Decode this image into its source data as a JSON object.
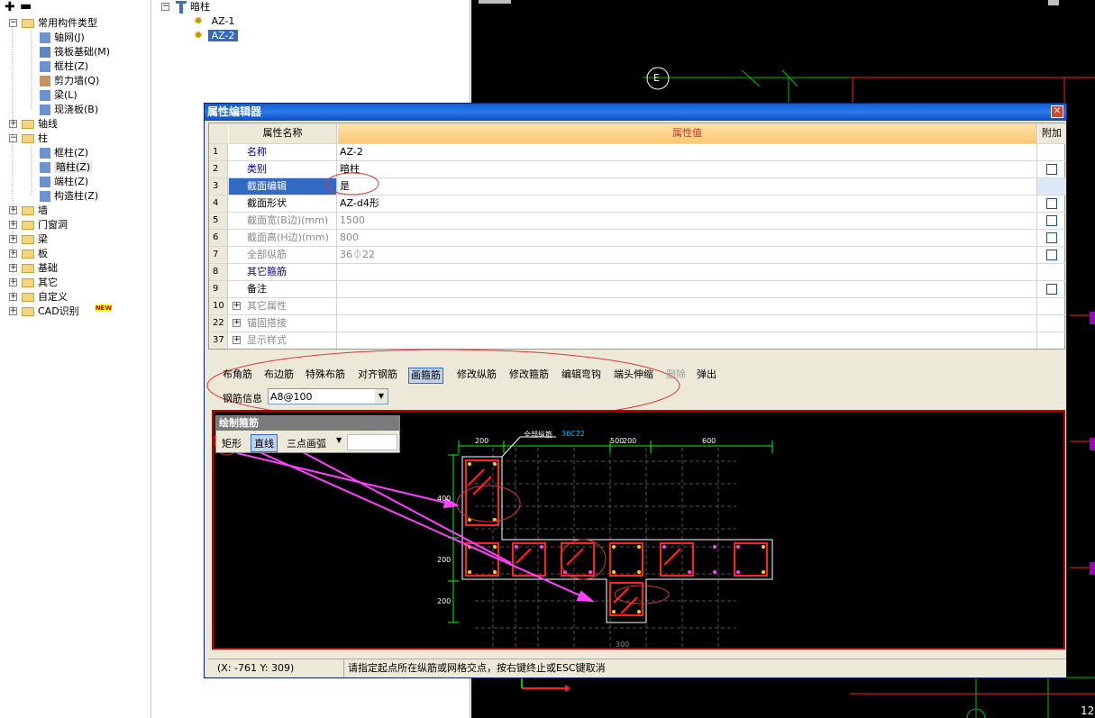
{
  "left_tree": {
    "items": [
      {
        "label": "常用构件类型",
        "level": 0,
        "expander": "⊟",
        "kind": "folder"
      },
      {
        "label": "轴网(J)",
        "level": 1,
        "kind": "grid"
      },
      {
        "label": "筏板基础(M)",
        "level": 1,
        "kind": "raft"
      },
      {
        "label": "框柱(Z)",
        "level": 1,
        "kind": "column"
      },
      {
        "label": "剪力墙(Q)",
        "level": 1,
        "kind": "wall"
      },
      {
        "label": "梁(L)",
        "level": 1,
        "kind": "beam"
      },
      {
        "label": "现浇板(B)",
        "level": 1,
        "kind": "slab"
      },
      {
        "label": "轴线",
        "level": 0,
        "expander": "⊞",
        "kind": "folder"
      },
      {
        "label": "柱",
        "level": 0,
        "expander": "⊟",
        "kind": "folder"
      },
      {
        "label": "框柱(Z)",
        "level": 1,
        "kind": "column"
      },
      {
        "label": "暗柱(Z)",
        "level": 1,
        "kind": "column"
      },
      {
        "label": "端柱(Z)",
        "level": 1,
        "kind": "column"
      },
      {
        "label": "构造柱(Z)",
        "level": 1,
        "kind": "column"
      },
      {
        "label": "墙",
        "level": 0,
        "expander": "⊞",
        "kind": "folder"
      },
      {
        "label": "门窗洞",
        "level": 0,
        "expander": "⊞",
        "kind": "folder"
      },
      {
        "label": "梁",
        "level": 0,
        "expander": "⊞",
        "kind": "folder"
      },
      {
        "label": "板",
        "level": 0,
        "expander": "⊞",
        "kind": "folder"
      },
      {
        "label": "基础",
        "level": 0,
        "expander": "⊞",
        "kind": "folder"
      },
      {
        "label": "其它",
        "level": 0,
        "expander": "⊞",
        "kind": "folder"
      },
      {
        "label": "自定义",
        "level": 0,
        "expander": "⊞",
        "kind": "folder"
      },
      {
        "label": "CAD识别",
        "level": 0,
        "expander": "⊞",
        "kind": "folder",
        "badge": "NEW"
      }
    ]
  },
  "mid_tree": {
    "root": "暗柱",
    "items": [
      "AZ-1",
      "AZ-2"
    ]
  },
  "canvas": {
    "axis_label": "E",
    "corner_text": "12"
  },
  "dialog": {
    "title": "属性编辑器",
    "col_name": "属性名称",
    "col_value": "属性值",
    "col_extra": "附加",
    "rows": [
      {
        "no": "1",
        "name": "名称",
        "value": "AZ-2",
        "style": "blue",
        "check": false
      },
      {
        "no": "2",
        "name": "类别",
        "value": "暗柱",
        "style": "blue",
        "check": true
      },
      {
        "no": "3",
        "name": "截面编辑",
        "value": "是",
        "style": "selected",
        "check": false
      },
      {
        "no": "4",
        "name": "截面形状",
        "value": "AZ-d4形",
        "style": "normal",
        "check": true
      },
      {
        "no": "5",
        "name": "截面宽(B边)(mm)",
        "value": "1500",
        "style": "gray",
        "check": true
      },
      {
        "no": "6",
        "name": "截面高(H边)(mm)",
        "value": "800",
        "style": "gray",
        "check": true
      },
      {
        "no": "7",
        "name": "全部纵筋",
        "value": "36⏀22",
        "style": "gray",
        "check": true
      },
      {
        "no": "8",
        "name": "其它箍筋",
        "value": "",
        "style": "blue",
        "check": false
      },
      {
        "no": "9",
        "name": "备注",
        "value": "",
        "style": "normal",
        "check": true
      },
      {
        "no": "10",
        "name": "其它属性",
        "value": "",
        "style": "group",
        "check": false
      },
      {
        "no": "22",
        "name": "锚固搭接",
        "value": "",
        "style": "group",
        "check": false
      },
      {
        "no": "37",
        "name": "显示样式",
        "value": "",
        "style": "group",
        "check": false
      }
    ],
    "toolbar": [
      "布角筋",
      "布边筋",
      "特殊布筋",
      "对齐钢筋",
      "画箍筋",
      "修改纵筋",
      "修改箍筋",
      "编辑弯钩",
      "端头伸缩",
      "删除",
      "弹出"
    ],
    "toolbar_active": "画箍筋",
    "toolbar_disabled": "删除",
    "rebar_info_label": "钢筋信息",
    "rebar_info_value": "A8@100",
    "palette": {
      "title": "绘制箍筋",
      "rect": "矩形",
      "line": "直线",
      "arc": "三点画弧"
    },
    "drawing": {
      "dims_top": [
        "200",
        "500",
        "200",
        "600"
      ],
      "dims_left": [
        "400",
        "200",
        "200"
      ],
      "note": "全部纵筋",
      "note_value": "36C22",
      "bottom_dim": "300"
    },
    "status": {
      "coords": "(X: -761 Y: 309)",
      "message": "请指定起点所在纵筋或网格交点，按右键终止或ESC键取消"
    }
  }
}
